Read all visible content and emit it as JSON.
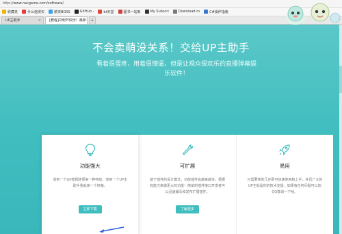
{
  "browser": {
    "url_prefix": "http://",
    "url": "www.nacgame.com/software/",
    "bookmarks": [
      {
        "label": "收藏夹",
        "icon": "star-icon",
        "color": "#f0b400"
      },
      {
        "label": "什么值得买",
        "icon": "site-icon",
        "color": "#e23c3c"
      },
      {
        "label": "薪资BOSS",
        "icon": "site-icon",
        "color": "#3aa0e8"
      },
      {
        "label": "GitHub -",
        "icon": "github-icon",
        "color": "#222222"
      },
      {
        "label": "bt天堂",
        "icon": "site-icon",
        "color": "#e0463a"
      },
      {
        "label": "图书一站到",
        "icon": "site-icon",
        "color": "#d04040"
      },
      {
        "label": "My Subscri",
        "icon": "v-icon",
        "color": "#333333"
      },
      {
        "label": "Download m",
        "icon": "site-icon",
        "color": "#7a7a7a"
      },
      {
        "label": "C#操作指南",
        "icon": "site-icon",
        "color": "#3a78d4"
      }
    ],
    "tabs": [
      {
        "label": "UP主助手",
        "active": false
      },
      {
        "label": "[教程]冲刺节快乐！最新",
        "active": true
      }
    ]
  },
  "hero": {
    "title": "不会卖萌没关系！交给UP主助手",
    "subtitle": "看着很蛋疼，用着很懵逼，但是让观众很欢乐的直播弹幕娱乐软件！"
  },
  "features": [
    {
      "icon": "lightbulb-icon",
      "title": "功能强大",
      "desc": "收到一个Gif按我随便来一种特效，收到一个UP主助手我就来一个好萌。",
      "button": "立即下载",
      "highlight": true
    },
    {
      "icon": "wrench-icon",
      "title": "可扩展",
      "desc": "基于插件的设计模式，功能插件会越来越多。根据有能力来做更大的功能！简单的插件接口开发者可以迅速编写和发布扩展插件。",
      "button": "了解更多",
      "highlight": false
    },
    {
      "icon": "rocket-icon",
      "title": "易用",
      "desc": "只需要简单几步即可快速使用和上手，并且广大的UP主就是你的技术支援，如果有任何问题可以加QQ群询一下哈。",
      "button": "",
      "highlight": false
    }
  ],
  "colors": {
    "accent": "#3fbdbf",
    "hero_top": "#5bc7c8",
    "arrow": "#2b5fd6"
  }
}
